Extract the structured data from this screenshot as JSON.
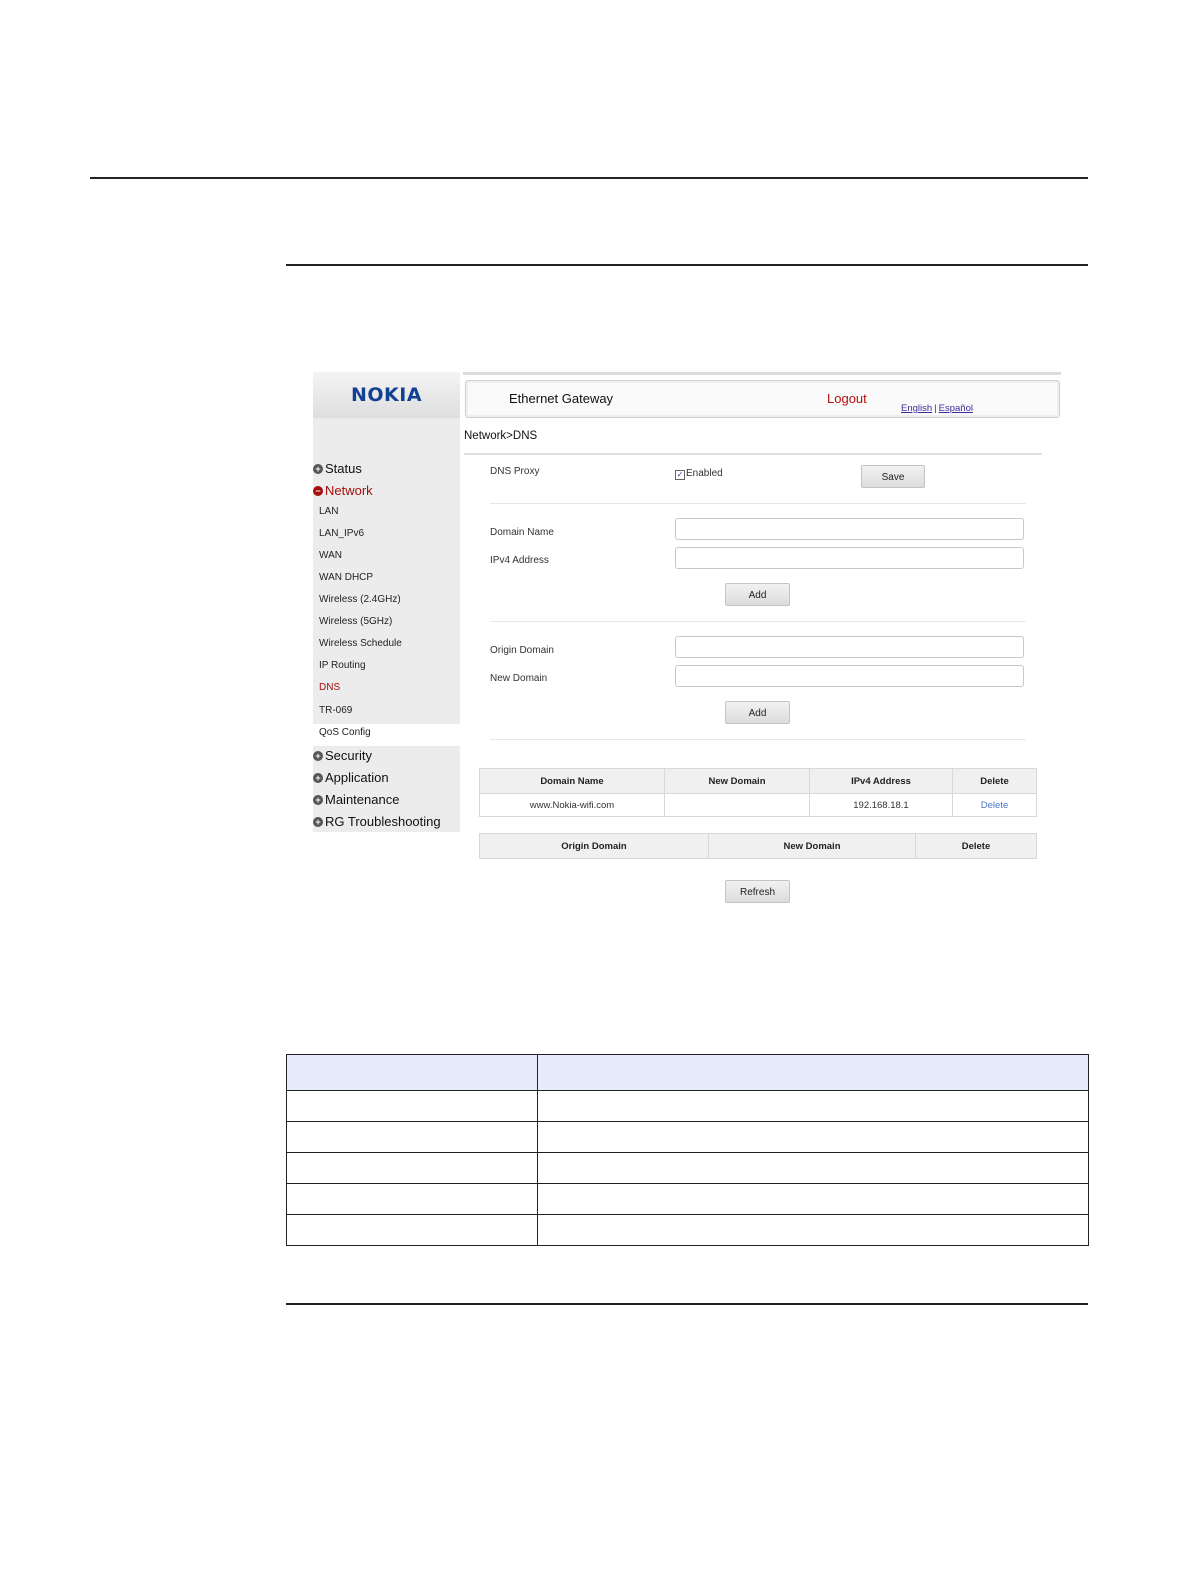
{
  "brand": {
    "logo": "NOKIA"
  },
  "header": {
    "title": "Ethernet Gateway",
    "logout": "Logout",
    "lang_english": "English",
    "lang_separator": "|",
    "lang_espanol": "Español"
  },
  "sidebar": {
    "status": "Status",
    "network": "Network",
    "network_items": [
      "LAN",
      "LAN_IPv6",
      "WAN",
      "WAN DHCP",
      "Wireless (2.4GHz)",
      "Wireless (5GHz)",
      "Wireless Schedule",
      "IP Routing",
      "DNS",
      "TR-069",
      "QoS Config"
    ],
    "security": "Security",
    "application": "Application",
    "maintenance": "Maintenance",
    "rg_troubleshooting": "RG Troubleshooting"
  },
  "breadcrumb": "Network>DNS",
  "dns_proxy": {
    "label": "DNS Proxy",
    "checkbox_label": "Enabled",
    "checked": true,
    "save": "Save"
  },
  "host_form": {
    "domain_label": "Domain Name",
    "domain_value": "",
    "ipv4_label": "IPv4 Address",
    "ipv4_value": "",
    "add": "Add"
  },
  "rename_form": {
    "origin_label": "Origin Domain",
    "origin_value": "",
    "new_label": "New Domain",
    "new_value": "",
    "add": "Add"
  },
  "host_table": {
    "headers": [
      "Domain Name",
      "New Domain",
      "IPv4 Address",
      "Delete"
    ],
    "rows": [
      {
        "domain": "www.Nokia-wifi.com",
        "new_domain": "",
        "ipv4": "192.168.18.1",
        "delete": "Delete"
      }
    ]
  },
  "rename_table": {
    "headers": [
      "Origin Domain",
      "New Domain",
      "Delete"
    ]
  },
  "refresh": "Refresh"
}
